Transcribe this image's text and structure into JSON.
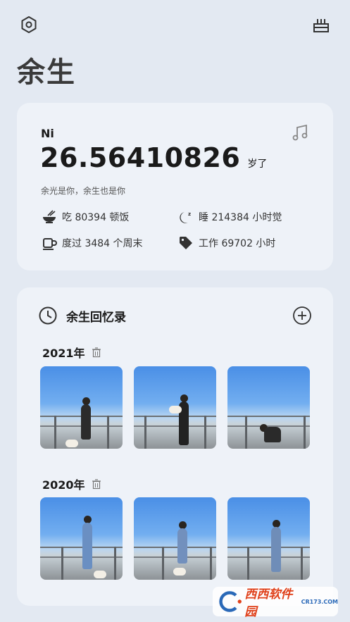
{
  "header": {
    "settings_icon": "gear-icon",
    "cake_icon": "cake-icon"
  },
  "page_title": "余生",
  "life_card": {
    "name": "Ni",
    "music_icon": "music-note-icon",
    "age": "26.56410826",
    "age_unit": "岁了",
    "quote": "余光是你，余生也是你",
    "stats": [
      {
        "icon": "bowl-icon",
        "text": "吃 80394 顿饭"
      },
      {
        "icon": "moon-sleep-icon",
        "text": "睡 214384 小时觉"
      },
      {
        "icon": "mug-icon",
        "text": "度过 3484 个周末"
      },
      {
        "icon": "tag-icon",
        "text": "工作 69702 小时"
      }
    ]
  },
  "memories": {
    "title": "余生回忆录",
    "clock_icon": "clock-icon",
    "add_icon": "plus-circle-icon",
    "years": [
      {
        "label": "2021年",
        "photo_count": 3
      },
      {
        "label": "2020年",
        "photo_count": 3
      }
    ]
  },
  "watermark": {
    "text": "西西软件园",
    "sub": "CR173.COM"
  },
  "colors": {
    "background": "#e3e9f2",
    "card": "#eef2f8",
    "text": "#1a1a1a"
  }
}
